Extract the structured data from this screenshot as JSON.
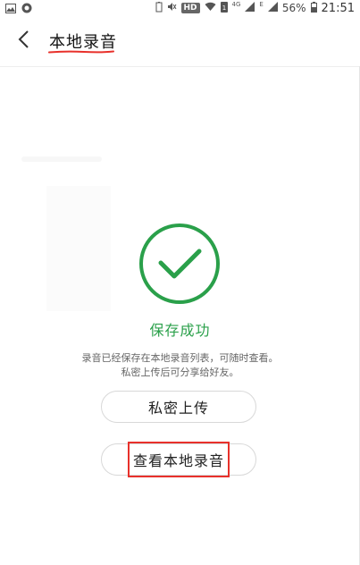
{
  "status_bar": {
    "hd_label": "HD",
    "net_label_1": "4G",
    "net_label_2": "E",
    "battery_percent": "56%",
    "time": "21:51",
    "icons": [
      "image-icon",
      "app-icon",
      "battery-saver-icon",
      "mute-icon",
      "wifi-icon",
      "sim-1-icon",
      "signal-icon",
      "signal-icon",
      "battery-icon"
    ]
  },
  "header": {
    "back_icon": "chevron-left-icon",
    "title": "本地录音"
  },
  "success": {
    "icon": "check-circle-icon",
    "title": "保存成功",
    "desc_line1": "录音已经保存在本地录音列表，可随时查看。",
    "desc_line2": "私密上传后可分享给好友。"
  },
  "actions": {
    "upload_label": "私密上传",
    "view_label": "查看本地录音"
  },
  "colors": {
    "accent_green": "#2aa04a",
    "annotation_red": "#e8312b"
  }
}
